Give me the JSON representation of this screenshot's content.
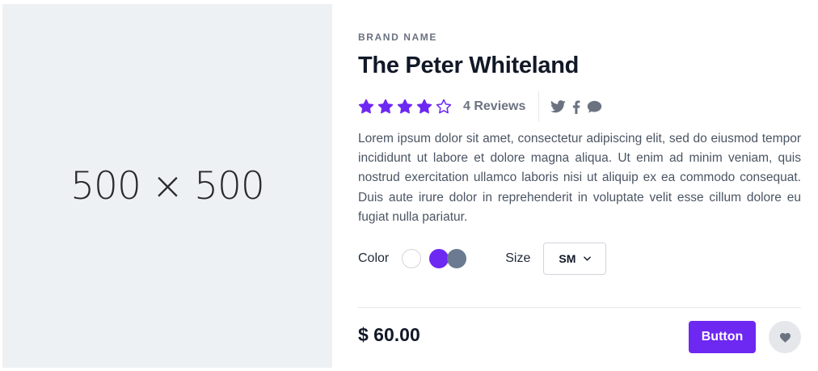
{
  "product_image": {
    "placeholder_text": "500 × 500"
  },
  "product": {
    "brand": "BRAND NAME",
    "title": "The Peter Whiteland",
    "rating": 4,
    "rating_max": 5,
    "reviews_label": "4 Reviews",
    "description": "Lorem ipsum dolor sit amet, consectetur adipiscing elit, sed do eiusmod tempor incididunt ut labore et dolore magna aliqua. Ut enim ad minim veniam, quis nostrud exercitation ullamco laboris nisi ut aliquip ex ea commodo consequat. Duis aute irure dolor in reprehenderit in voluptate velit esse cillum dolore eu fugiat nulla pariatur.",
    "price": "$ 60.00"
  },
  "social": [
    "twitter-icon",
    "facebook-icon",
    "chat-icon"
  ],
  "options": {
    "color_label": "Color",
    "colors": [
      "#ffffff",
      "#6d28f2",
      "#6b7a91"
    ],
    "size_label": "Size",
    "size_value": "SM"
  },
  "actions": {
    "buy_label": "Button"
  },
  "theme": {
    "accent": "#6d28f2",
    "muted": "#6b7280"
  }
}
